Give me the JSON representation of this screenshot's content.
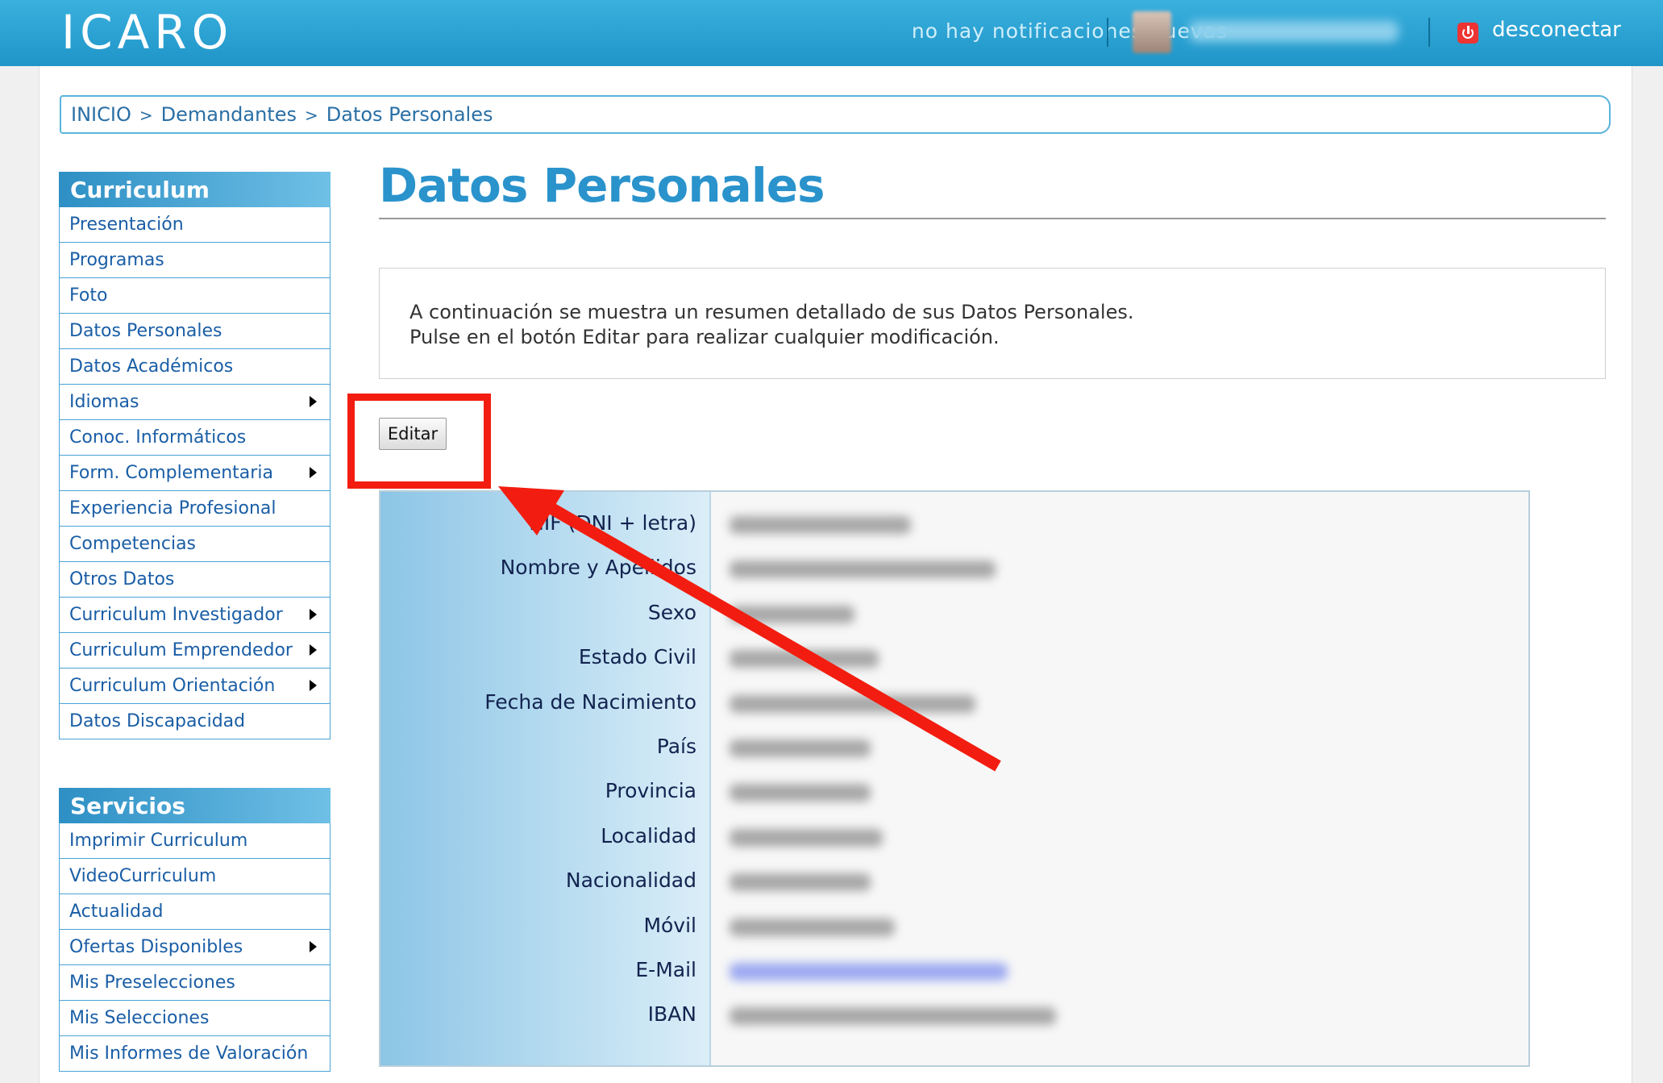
{
  "header": {
    "logo": "ICARO",
    "notifications": "no hay notificaciones nuevas",
    "logout": "desconectar"
  },
  "breadcrumb": [
    "INICIO",
    "Demandantes",
    "Datos Personales"
  ],
  "sidebar": {
    "curriculum": {
      "title": "Curriculum",
      "items": [
        {
          "label": "Presentación",
          "submenu": false
        },
        {
          "label": "Programas",
          "submenu": false
        },
        {
          "label": "Foto",
          "submenu": false
        },
        {
          "label": "Datos Personales",
          "submenu": false
        },
        {
          "label": "Datos Académicos",
          "submenu": false
        },
        {
          "label": "Idiomas",
          "submenu": true
        },
        {
          "label": "Conoc. Informáticos",
          "submenu": false
        },
        {
          "label": "Form. Complementaria",
          "submenu": true
        },
        {
          "label": "Experiencia Profesional",
          "submenu": false
        },
        {
          "label": "Competencias",
          "submenu": false
        },
        {
          "label": "Otros Datos",
          "submenu": false
        },
        {
          "label": "Curriculum Investigador",
          "submenu": true
        },
        {
          "label": "Curriculum Emprendedor",
          "submenu": true
        },
        {
          "label": "Curriculum Orientación",
          "submenu": true
        },
        {
          "label": "Datos Discapacidad",
          "submenu": false
        }
      ]
    },
    "servicios": {
      "title": "Servicios",
      "items": [
        {
          "label": "Imprimir Curriculum",
          "submenu": false
        },
        {
          "label": "VideoCurriculum",
          "submenu": false
        },
        {
          "label": "Actualidad",
          "submenu": false
        },
        {
          "label": "Ofertas Disponibles",
          "submenu": true
        },
        {
          "label": "Mis Preselecciones",
          "submenu": false
        },
        {
          "label": "Mis Selecciones",
          "submenu": false
        },
        {
          "label": "Mis Informes de Valoración",
          "submenu": false
        }
      ]
    }
  },
  "main": {
    "title": "Datos Personales",
    "info_line1": "A continuación se muestra un resumen detallado de sus Datos Personales.",
    "info_line2": "Pulse en el botón Editar para realizar cualquier modificación.",
    "edit_button": "Editar",
    "fields": [
      "NIF (DNI + letra)",
      "Nombre y Apellidos",
      "Sexo",
      "Estado Civil",
      "Fecha de Nacimiento",
      "País",
      "Provincia",
      "Localidad",
      "Nacionalidad",
      "Móvil",
      "E-Mail",
      "IBAN"
    ]
  },
  "colors": {
    "header": "#1f95c8",
    "accent": "#2a93cc",
    "annotation": "#f21d10"
  }
}
